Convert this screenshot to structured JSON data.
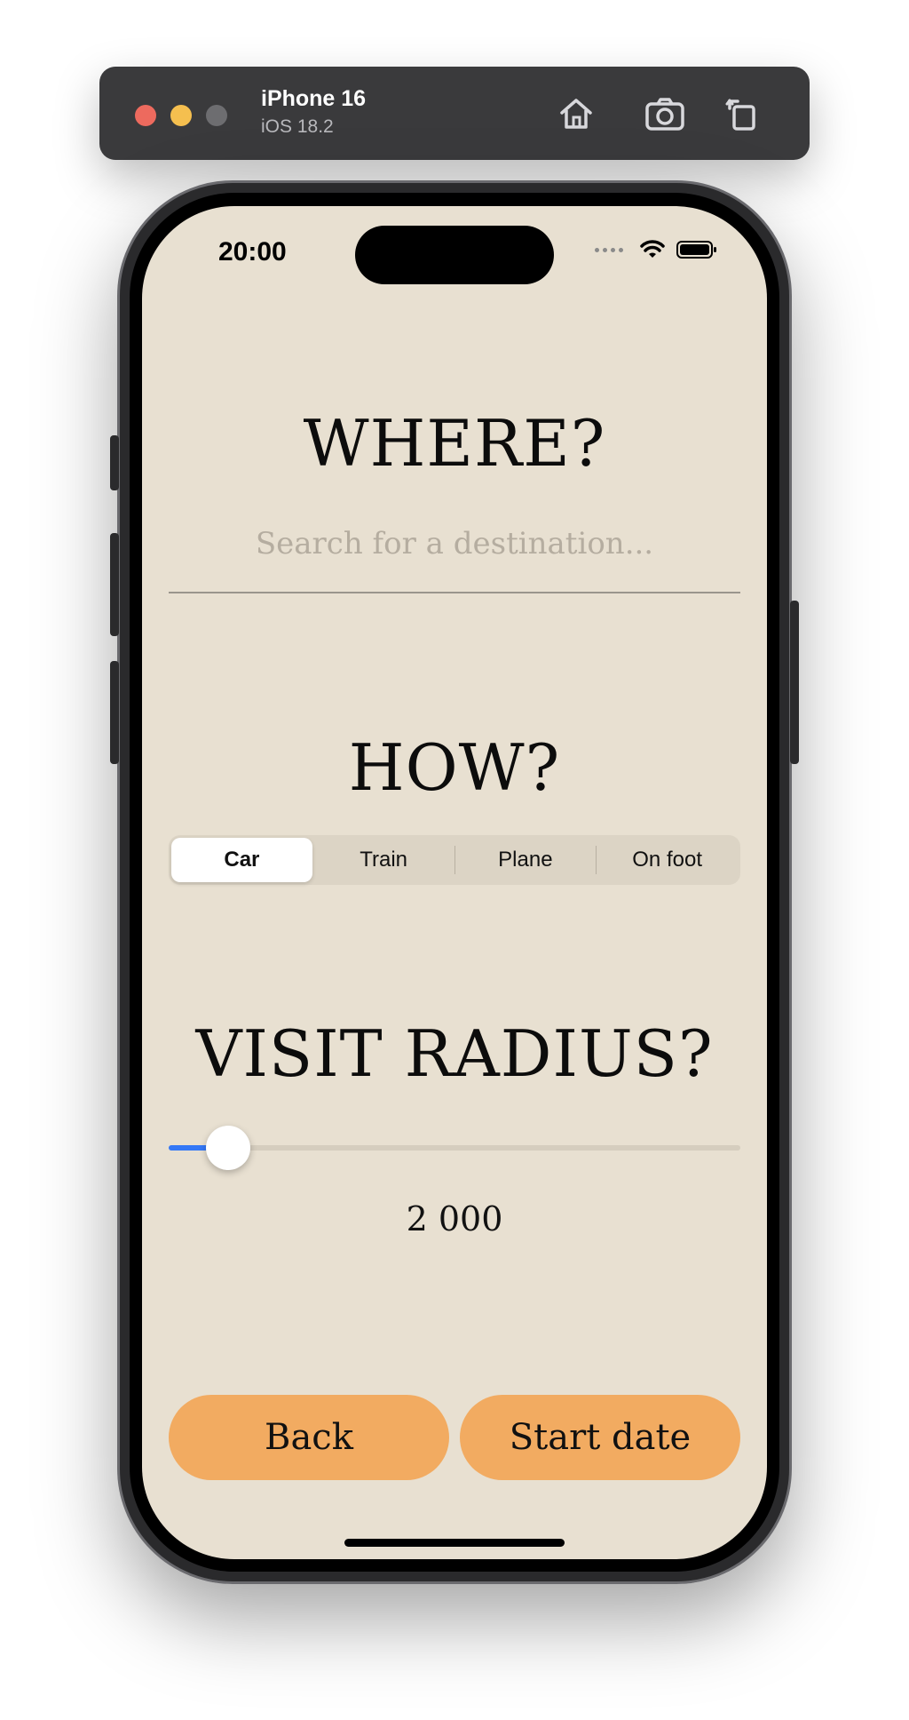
{
  "simulator": {
    "device_name": "iPhone 16",
    "os_version": "iOS 18.2",
    "toolbar_icons": [
      "home-icon",
      "screenshot-icon",
      "rotate-icon"
    ]
  },
  "status_bar": {
    "time": "20:00",
    "icons": [
      "signal-dots-icon",
      "wifi-icon",
      "battery-icon"
    ]
  },
  "where": {
    "title": "WHERE?",
    "search_placeholder": "Search for a destination...",
    "search_value": ""
  },
  "how": {
    "title": "HOW?",
    "options": [
      "Car",
      "Train",
      "Plane",
      "On foot"
    ],
    "selected": "Car"
  },
  "visit_radius": {
    "title": "VISIT RADIUS?",
    "value_text": "2 000",
    "slider_fraction": 0.07,
    "accent_color": "#3478f6"
  },
  "actions": {
    "back_label": "Back",
    "start_date_label": "Start date",
    "button_color": "#f2ab61"
  },
  "colors": {
    "screen_background": "#e8e0d1"
  }
}
